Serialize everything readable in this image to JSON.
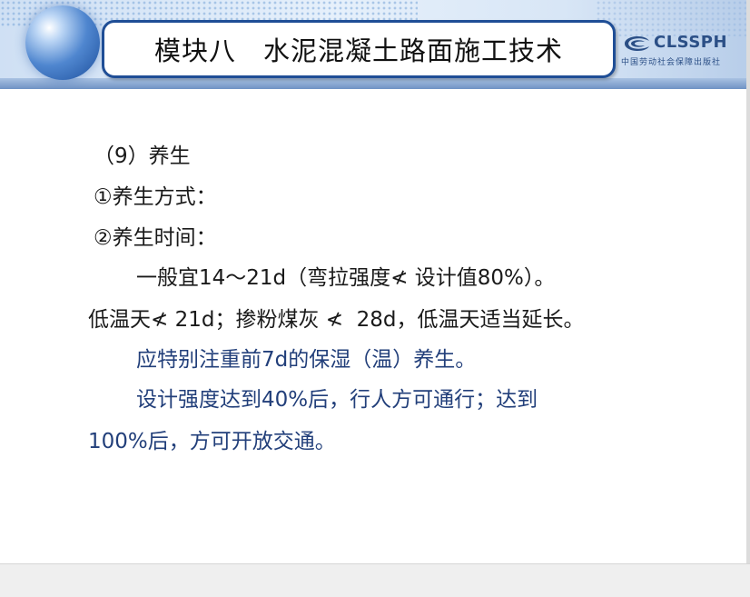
{
  "header": {
    "title": "模块八　水泥混凝土路面施工技术",
    "logo_text": "CLSSPH",
    "logo_subtitle": "中国劳动社会保障出版社",
    "colors": {
      "frame": "#1f4e96",
      "logo": "#2b4f86"
    }
  },
  "body": {
    "lines": [
      "（9）养生",
      "①养生方式：",
      "②养生时间：",
      "一般宜14～21d（弯拉强度≮ 设计值80%）。",
      "低温天≮ 21d；掺粉煤灰 ≮  28d，低温天适当延长。",
      "应特别注重前7d的保湿（温）养生。",
      "设计强度达到40%后，行人方可通行；达到",
      "100%后，方可开放交通。"
    ],
    "colors": {
      "text": "#1a1a1a",
      "highlight": "#223f7a"
    }
  }
}
